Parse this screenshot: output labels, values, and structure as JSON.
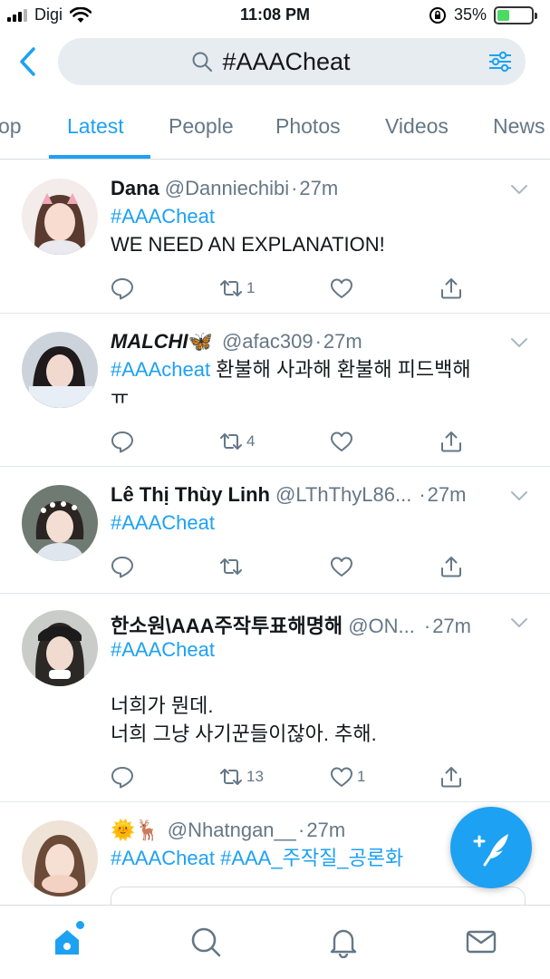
{
  "status_bar": {
    "carrier": "Digi",
    "time": "11:08 PM",
    "battery_percent": "35%",
    "battery_level": 0.35
  },
  "search": {
    "query": "#AAACheat"
  },
  "tabs": [
    {
      "label": "op",
      "active": false
    },
    {
      "label": "Latest",
      "active": true
    },
    {
      "label": "People",
      "active": false
    },
    {
      "label": "Photos",
      "active": false
    },
    {
      "label": "Videos",
      "active": false
    },
    {
      "label": "News",
      "active": false
    }
  ],
  "tweets": [
    {
      "name": "Dana",
      "handle": "@Danniechibi",
      "time": "27m",
      "hashtag": "#AAACheat",
      "text": "WE NEED AN EXPLANATION!",
      "replies": "",
      "retweets": "1",
      "likes": ""
    },
    {
      "name": "MALCHI",
      "name_emoji": "🦋",
      "handle": "@afac309",
      "time": "27m",
      "hashtag": "#AAAcheat",
      "text_inline": " 환불해 사과해 환불해 피드백해",
      "text_line2": "ㅠ",
      "replies": "",
      "retweets": "4",
      "likes": ""
    },
    {
      "name": "Lê Thị Thùy Linh",
      "handle": "@LThThyL86...",
      "time": "27m",
      "hashtag": "#AAACheat",
      "replies": "",
      "retweets": "",
      "likes": ""
    },
    {
      "name": "한소원\\AAA주작투표해명해",
      "handle": "@ON...",
      "time": "27m",
      "hashtag": "#AAACheat",
      "text_line1": "너희가 뭔데.",
      "text_line2": "너희 그냥 사기꾼들이잖아. 추해.",
      "replies": "",
      "retweets": "13",
      "likes": "1"
    },
    {
      "name": "🌞🦌",
      "handle": "@Nhatngan__",
      "time": "27m",
      "hashtag": "#AAACheat",
      "hashtag2": "#AAA_주작질_공론화"
    }
  ],
  "bottom_nav": [
    "home-icon",
    "search-icon",
    "notifications-icon",
    "messages-icon"
  ],
  "colors": {
    "accent": "#1da1f2",
    "muted": "#657786",
    "text": "#14171a"
  }
}
